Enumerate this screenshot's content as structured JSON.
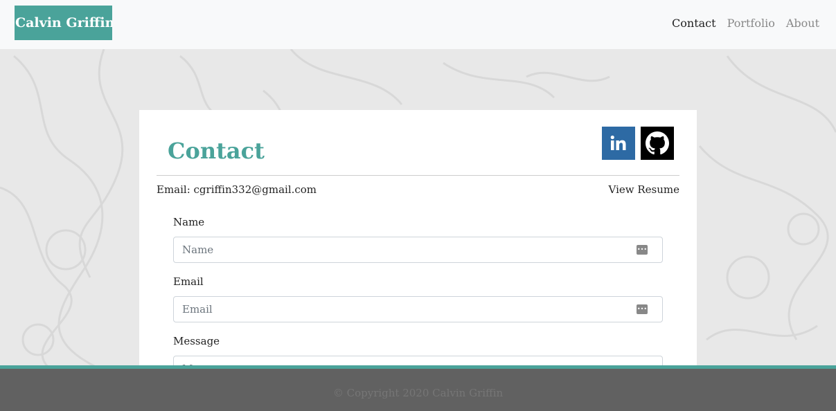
{
  "navbar": {
    "brand": "Calvin Griffin",
    "links": [
      {
        "label": "Contact",
        "active": true
      },
      {
        "label": "Portfolio",
        "active": false
      },
      {
        "label": "About",
        "active": false
      }
    ]
  },
  "contact": {
    "title": "Contact",
    "email_line": "Email: cgriffin332@gmail.com",
    "resume_label": "View Resume",
    "social": [
      {
        "name": "LinkedIn",
        "icon": "linkedin-icon",
        "color": "#2d6aa4"
      },
      {
        "name": "GitHub",
        "icon": "github-icon",
        "color": "#000000"
      }
    ],
    "form": {
      "name_label": "Name",
      "name_placeholder": "Name",
      "email_label": "Email",
      "email_placeholder": "Email",
      "message_label": "Message",
      "message_placeholder": "Message"
    }
  },
  "footer": {
    "copyright": "© Copyright 2020 Calvin Griffin"
  },
  "colors": {
    "accent": "#4aa39a",
    "footer_bg": "#616161",
    "navbar_bg": "#f8f9fa"
  }
}
